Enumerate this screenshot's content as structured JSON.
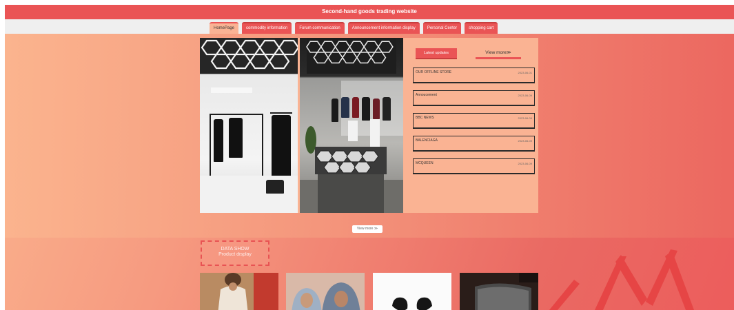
{
  "site": {
    "title": "Second-hand goods trading website"
  },
  "nav": {
    "items": [
      {
        "label": "HomePage",
        "active": true
      },
      {
        "label": "commodity information",
        "active": false
      },
      {
        "label": "Forum communication",
        "active": false
      },
      {
        "label": "Announcement information display",
        "active": false
      },
      {
        "label": "Personal Center",
        "active": false
      },
      {
        "label": "shopping cart",
        "active": false
      }
    ]
  },
  "news": {
    "tab_latest": "Latest updates",
    "tab_more": "View more≫",
    "items": [
      {
        "title": "OUR OFFLINE STORE",
        "date": "2023-06-01"
      },
      {
        "title": "Annoucement",
        "date": "2023-06-09"
      },
      {
        "title": "BBC NEWS",
        "date": "2023-06-09"
      },
      {
        "title": "BALENCIAGA",
        "date": "2023-06-09"
      },
      {
        "title": "MCQUEEN",
        "date": "2023-06-09"
      }
    ]
  },
  "view_more_button": "View more ≫",
  "section": {
    "line1": "DATA SHOW",
    "line2": "Product display"
  },
  "colors": {
    "brand": "#ea5455",
    "panel": "#fab393",
    "nav_bg": "#efefef"
  }
}
